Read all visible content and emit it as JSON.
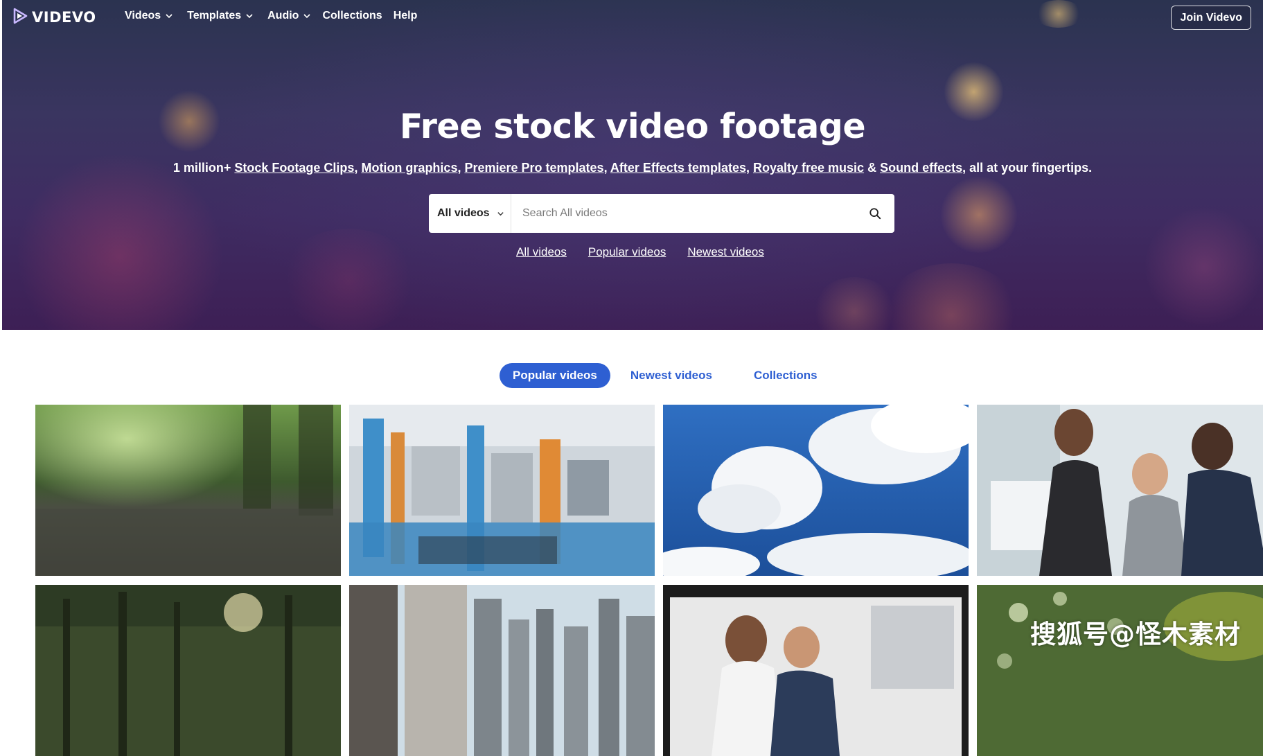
{
  "brand": {
    "name": "VIDEVO",
    "logo_icon": "play-triangle-icon"
  },
  "nav": {
    "items": [
      {
        "label": "Videos",
        "has_dropdown": true
      },
      {
        "label": "Templates",
        "has_dropdown": true
      },
      {
        "label": "Audio",
        "has_dropdown": true
      },
      {
        "label": "Collections",
        "has_dropdown": false
      },
      {
        "label": "Help",
        "has_dropdown": false
      }
    ],
    "join_label": "Join Videvo"
  },
  "hero": {
    "title": "Free stock video footage",
    "subtitle": {
      "prefix": "1 million+ ",
      "links": [
        "Stock Footage Clips",
        "Motion graphics",
        "Premiere Pro templates",
        "After Effects templates",
        "Royalty free music",
        "Sound effects"
      ],
      "sep": ", ",
      "amp": " & ",
      "suffix": ", all at your fingertips."
    },
    "search": {
      "category": "All videos",
      "placeholder": "Search All videos",
      "icon": "search-icon"
    },
    "quick_links": [
      "All videos",
      "Popular videos",
      "Newest videos"
    ]
  },
  "tabs": [
    {
      "label": "Popular videos",
      "active": true
    },
    {
      "label": "Newest videos",
      "active": false
    },
    {
      "label": "Collections",
      "active": false
    }
  ],
  "videos": [
    {
      "subject": "rain-on-forest-ground"
    },
    {
      "subject": "industrial-machinery"
    },
    {
      "subject": "clouds-blue-sky"
    },
    {
      "subject": "office-team-laptop"
    },
    {
      "subject": "forest-sunrise"
    },
    {
      "subject": "city-skyscrapers"
    },
    {
      "subject": "film-strip-business-people"
    },
    {
      "subject": "bokeh-leaves"
    }
  ],
  "watermark": "搜狐号@怪木素材",
  "colors": {
    "accent": "#2e5fd2",
    "hero_top": "#2b3350",
    "hero_bottom": "#3d1f55",
    "white": "#ffffff"
  }
}
